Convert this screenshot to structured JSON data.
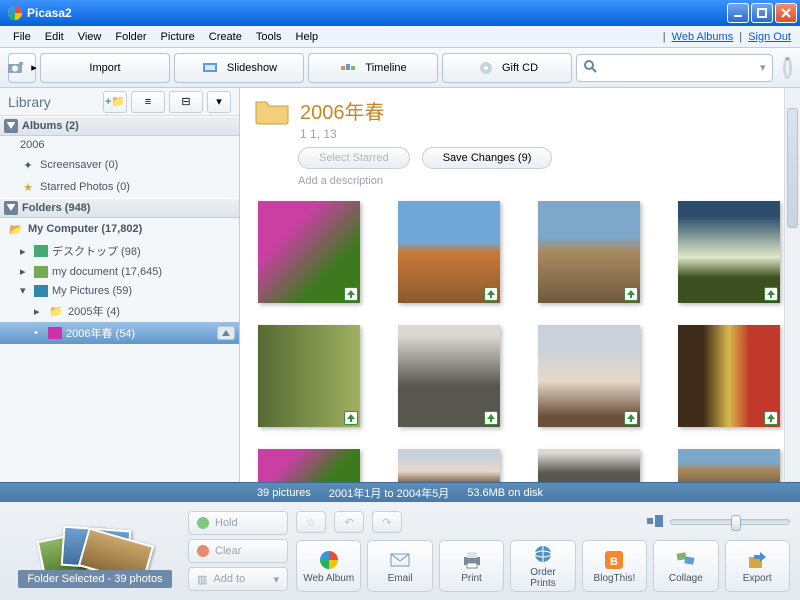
{
  "window": {
    "title": "Picasa2"
  },
  "menu": [
    "File",
    "Edit",
    "View",
    "Folder",
    "Picture",
    "Create",
    "Tools",
    "Help"
  ],
  "rightLinks": {
    "web": "Web Albums",
    "signout": "Sign Out"
  },
  "toolbar": {
    "import": "Import",
    "slideshow": "Slideshow",
    "timeline": "Timeline",
    "giftcd": "Gift CD",
    "searchPlaceholder": ""
  },
  "library": {
    "title": "Library",
    "albumsHeader": "Albums (2)",
    "albumYear": "2006",
    "albums": [
      {
        "label": "Screensaver (0)"
      },
      {
        "label": "Starred Photos (0)"
      }
    ],
    "foldersHeader": "Folders (948)",
    "myComputer": "My Computer (17,802)",
    "desktop": "デスクトップ (98)",
    "mydoc": "my document (17,645)",
    "mypics": "My Pictures (59)",
    "y2005": "2005年 (4)",
    "y2006spring": "2006年春 (54)"
  },
  "folder": {
    "title": "2006年春",
    "subtitle": "1 1, 13",
    "selectStarred": "Select Starred",
    "saveChanges": "Save Changes (9)",
    "desc": "Add a description"
  },
  "status": {
    "count": "39 pictures",
    "range": "2001年1月 to 2004年5月",
    "size": "53.6MB on disk"
  },
  "tray": {
    "caption": "Folder Selected - 39 photos"
  },
  "mid": {
    "hold": "Hold",
    "clear": "Clear",
    "addto": "Add to"
  },
  "actions": {
    "webalbum": "Web Album",
    "email": "Email",
    "print": "Print",
    "order": "Order\nPrints",
    "blog": "BlogThis!",
    "collage": "Collage",
    "export": "Export"
  }
}
